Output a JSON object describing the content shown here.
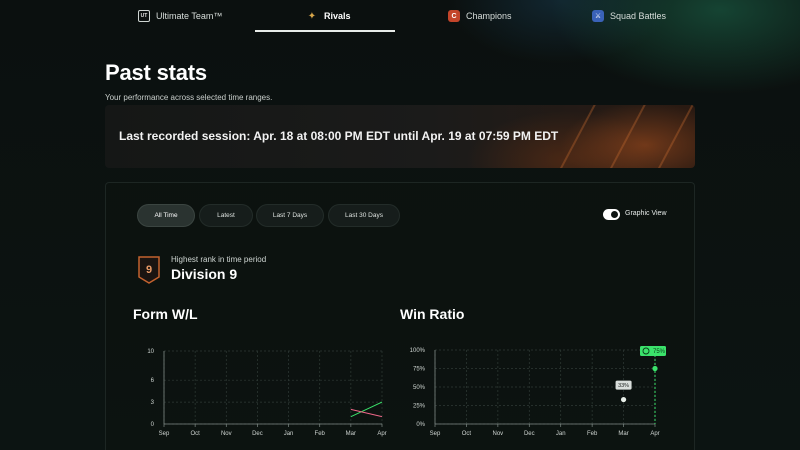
{
  "nav": {
    "tabs": [
      {
        "label": "Ultimate Team™",
        "icon": "ultimate-team-icon",
        "icon_text": "UT"
      },
      {
        "label": "Rivals",
        "icon": "rivals-icon",
        "icon_text": "✦",
        "active": true
      },
      {
        "label": "Champions",
        "icon": "champions-icon",
        "icon_text": "C"
      },
      {
        "label": "Squad Battles",
        "icon": "squad-battles-icon",
        "icon_text": "⚔"
      }
    ]
  },
  "header": {
    "title": "Past stats",
    "subtitle": "Your performance across selected time ranges."
  },
  "session": {
    "text": "Last recorded session:  Apr. 18 at 08:00 PM EDT until Apr. 19 at 07:59 PM EDT"
  },
  "filters": {
    "options": [
      "All Time",
      "Latest",
      "Last 7 Days",
      "Last 30 Days"
    ],
    "selected": "All Time"
  },
  "view_toggle": {
    "label": "Graphic View",
    "on": true
  },
  "rank": {
    "caption": "Highest rank in time period",
    "value": "Division 9",
    "badge_number": "9",
    "badge_color": "#c3622f"
  },
  "colors": {
    "accent_green": "#3be26b",
    "loss_pink": "#f0688a",
    "background": "#0b100f"
  },
  "chart_data": [
    {
      "type": "line",
      "title": "Form W/L",
      "categories": [
        "Sep",
        "Oct",
        "Nov",
        "Dec",
        "Jan",
        "Feb",
        "Mar",
        "Apr"
      ],
      "yticks": [
        "10",
        "6",
        "3",
        "0"
      ],
      "ylim": [
        0,
        10
      ],
      "series": [
        {
          "values": [
            null,
            null,
            null,
            null,
            null,
            null,
            1,
            3
          ],
          "color": "#3be26b"
        },
        {
          "values": [
            null,
            null,
            null,
            null,
            null,
            null,
            2,
            1
          ],
          "color": "#f0688a"
        }
      ],
      "grid": true
    },
    {
      "type": "scatter",
      "title": "Win Ratio",
      "categories": [
        "Sep",
        "Oct",
        "Nov",
        "Dec",
        "Jan",
        "Feb",
        "Mar",
        "Apr"
      ],
      "yticks": [
        "100%",
        "75%",
        "50%",
        "25%",
        "0%"
      ],
      "ylim": [
        0,
        100
      ],
      "series": [
        {
          "values": [
            null,
            null,
            null,
            null,
            null,
            null,
            33,
            75
          ],
          "color": "#ffffff"
        }
      ],
      "labels": [
        {
          "category": "Mar",
          "text": "33%"
        },
        {
          "category": "Apr",
          "text": "75%",
          "highlight": true
        }
      ],
      "grid": true
    }
  ]
}
